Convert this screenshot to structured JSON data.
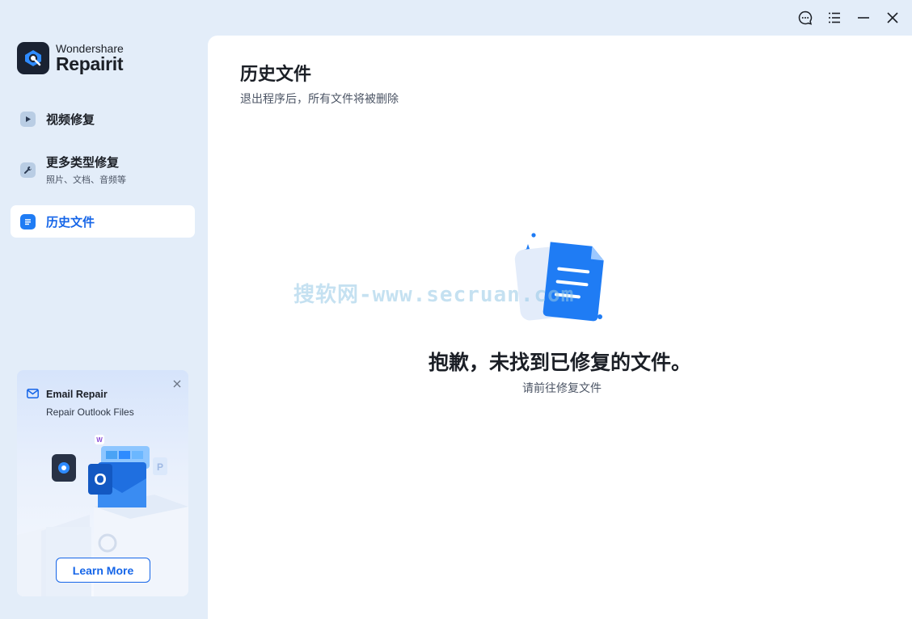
{
  "window": {
    "controls": [
      "feedback-icon",
      "menu-icon",
      "minimize-icon",
      "close-icon"
    ]
  },
  "brand": {
    "company": "Wondershare",
    "product": "Repairit"
  },
  "sidebar": {
    "items": [
      {
        "label": "视频修复",
        "sub": "",
        "icon": "play-icon",
        "active": false
      },
      {
        "label": "更多类型修复",
        "sub": "照片、文档、音频等",
        "icon": "wrench-icon",
        "active": false
      },
      {
        "label": "历史文件",
        "sub": "",
        "icon": "file-list-icon",
        "active": true
      }
    ]
  },
  "promo": {
    "title": "Email Repair",
    "subtitle": "Repair Outlook Files",
    "button": "Learn More",
    "icon": "mail-icon"
  },
  "main": {
    "title": "历史文件",
    "subtitle": "退出程序后，所有文件将被删除",
    "empty_title": "抱歉，未找到已修复的文件。",
    "empty_sub": "请前往修复文件"
  },
  "watermark": "搜软网-www.secruan.com",
  "colors": {
    "accent": "#1565e8",
    "sidebar_bg": "#e3edf9",
    "panel_bg": "#ffffff"
  }
}
